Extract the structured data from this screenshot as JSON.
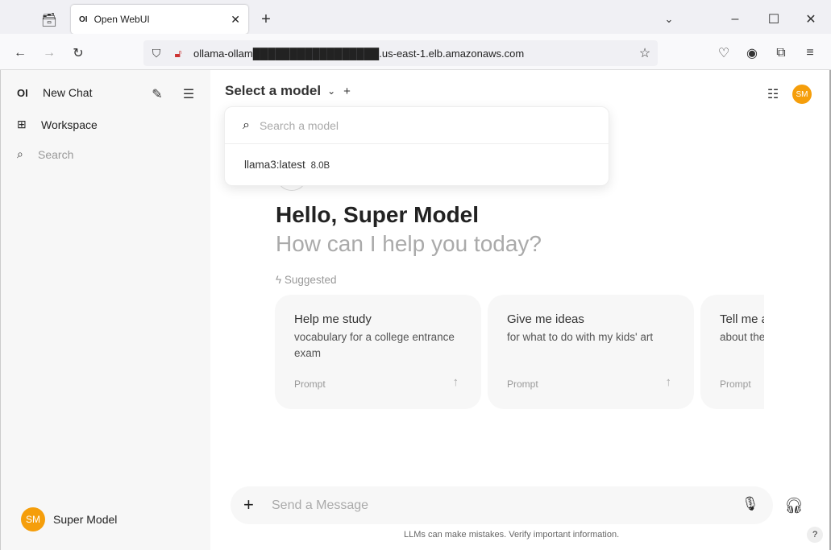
{
  "browser": {
    "tab_title": "Open WebUI",
    "tab_favicon": "OI",
    "url": "ollama-ollam█████████████████.us-east-1.elb.amazonaws.com"
  },
  "sidebar": {
    "logo": "OI",
    "new_chat": "New Chat",
    "workspace": "Workspace",
    "search_placeholder": "Search",
    "user_initials": "SM",
    "user_name": "Super Model"
  },
  "header": {
    "model_selector": "Select a model",
    "user_initials": "SM"
  },
  "model_dropdown": {
    "search_placeholder": "Search a model",
    "models": [
      {
        "name": "llama3:latest",
        "size": "8.0B"
      }
    ]
  },
  "main": {
    "greeting": "Hello, Super Model",
    "subtitle": "How can I help you today?",
    "suggested_label": "Suggested",
    "suggestions": [
      {
        "title": "Help me study",
        "subtitle": "vocabulary for a college entrance exam",
        "tag": "Prompt"
      },
      {
        "title": "Give me ideas",
        "subtitle": "for what to do with my kids' art",
        "tag": "Prompt"
      },
      {
        "title": "Tell me a",
        "subtitle": "about the",
        "tag": "Prompt"
      }
    ]
  },
  "composer": {
    "placeholder": "Send a Message"
  },
  "footer": {
    "disclaimer": "LLMs can make mistakes. Verify important information.",
    "help": "?"
  },
  "colors": {
    "accent": "#f59e0b"
  }
}
